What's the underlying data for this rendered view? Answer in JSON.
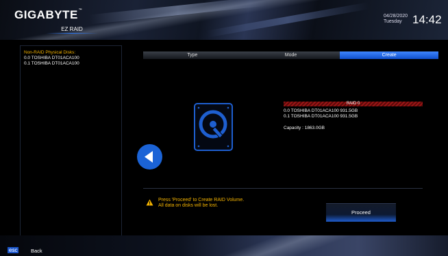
{
  "header": {
    "brand": "GIGABYTE",
    "trademark": "™",
    "mode": "EZ RAID",
    "date": "04/28/2020",
    "day": "Tuesday",
    "time": "14:42"
  },
  "left_panel": {
    "title": "Non-RAID Physical Disks:",
    "disks": [
      "0.0  TOSHIBA DT01ACA100",
      "0.1  TOSHIBA DT01ACA100"
    ]
  },
  "tabs": [
    {
      "label": "Type",
      "active": false
    },
    {
      "label": "Mode",
      "active": false
    },
    {
      "label": "Create",
      "active": true
    }
  ],
  "raid": {
    "title": "RAID 0",
    "members": [
      "0.0  TOSHIBA DT01ACA100 931.5GB",
      "0.1  TOSHIBA DT01ACA100 931.5GB"
    ],
    "capacity": "Capacity : 1863.0GB"
  },
  "icons": {
    "hdd": "hard-disk-icon",
    "back": "back-arrow-icon",
    "warning": "warning-icon"
  },
  "warning": {
    "line1": "Press 'Proceed' to Create RAID Volume.",
    "line2": "All data on disks will be lost."
  },
  "proceed_label": "Proceed",
  "footer": {
    "key": "esc",
    "label": "Back"
  },
  "colors": {
    "accent": "#1b63d6",
    "warning": "#f5b400",
    "raid_bar": "#9a1515"
  }
}
